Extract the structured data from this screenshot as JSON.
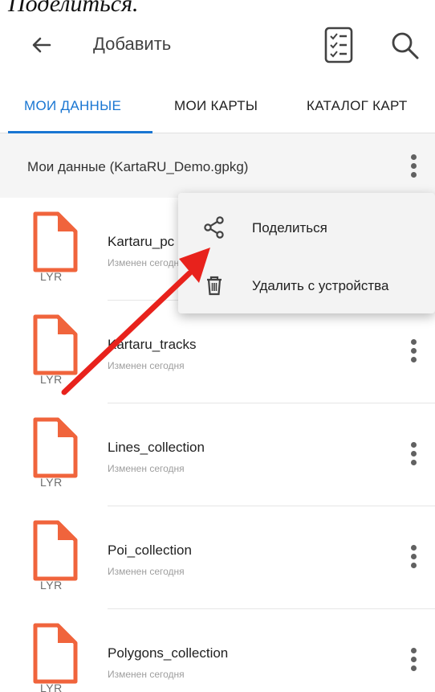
{
  "caption": "Поделиться.",
  "toolbar": {
    "title": "Добавить",
    "back_icon": "arrow-left-icon",
    "list_icon": "checklist-icon",
    "search_icon": "search-icon"
  },
  "tabs": [
    {
      "label": "МОИ ДАННЫЕ",
      "active": true
    },
    {
      "label": "МОИ КАРТЫ",
      "active": false
    },
    {
      "label": "КАТАЛОГ КАРТ",
      "active": false
    }
  ],
  "section": {
    "label": "Мои данные (KartaRU_Demo.gpkg)"
  },
  "files": [
    {
      "name": "Kartaru_pc",
      "subtitle": "Изменен сегодня",
      "badge": "LYR"
    },
    {
      "name": "Kartaru_tracks",
      "subtitle": "Изменен сегодня",
      "badge": "LYR"
    },
    {
      "name": "Lines_collection",
      "subtitle": "Изменен сегодня",
      "badge": "LYR"
    },
    {
      "name": "Poi_collection",
      "subtitle": "Изменен сегодня",
      "badge": "LYR"
    },
    {
      "name": "Polygons_collection",
      "subtitle": "Изменен сегодня",
      "badge": "LYR"
    }
  ],
  "menu": [
    {
      "label": "Поделиться",
      "icon": "share-icon"
    },
    {
      "label": "Удалить с устройства",
      "icon": "trash-icon"
    }
  ],
  "colors": {
    "accent": "#1976d2",
    "file_icon": "#f0643c",
    "arrow": "#e8221c"
  }
}
